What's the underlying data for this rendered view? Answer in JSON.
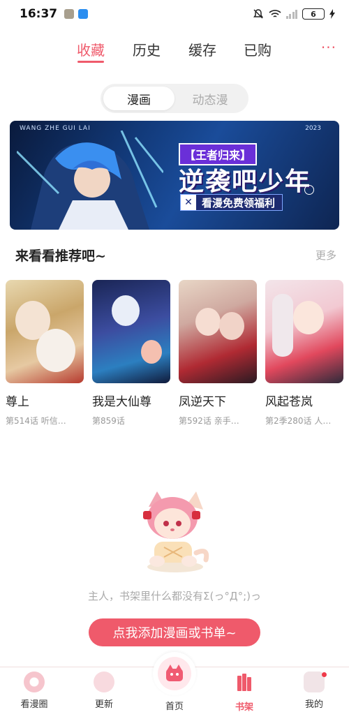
{
  "status_bar": {
    "time": "16:37",
    "battery": "6"
  },
  "top_tabs": [
    {
      "label": "收藏",
      "active": true
    },
    {
      "label": "历史",
      "active": false
    },
    {
      "label": "缓存",
      "active": false
    },
    {
      "label": "已购",
      "active": false
    }
  ],
  "more_dots": "···",
  "segment": [
    {
      "label": "漫画",
      "active": true
    },
    {
      "label": "动态漫",
      "active": false
    }
  ],
  "banner": {
    "deco_text": "WANG ZHE GUI LAI",
    "year": "2023",
    "badge": "【王者归来】",
    "title": "逆袭吧少年",
    "subtitle": "看漫免费领福利"
  },
  "recommend": {
    "title": "来看看推荐吧~",
    "more": "更多",
    "items": [
      {
        "title": "尊上",
        "subtitle": "第514话 听信…"
      },
      {
        "title": "我是大仙尊",
        "subtitle": "第859话"
      },
      {
        "title": "凤逆天下",
        "subtitle": "第592话 亲手…"
      },
      {
        "title": "风起苍岚",
        "subtitle": "第2季280话 人…"
      }
    ]
  },
  "empty_state": {
    "message": "主人，书架里什么都没有Σ(っ°Д°;)っ",
    "button": "点我添加漫画或书单~"
  },
  "bottom_nav": [
    {
      "label": "看漫圈",
      "active": false
    },
    {
      "label": "更新",
      "active": false
    },
    {
      "label": "首页",
      "active": false
    },
    {
      "label": "书架",
      "active": true
    },
    {
      "label": "我的",
      "active": false
    }
  ],
  "colors": {
    "accent": "#ef5a6b",
    "muted": "#aaaaaa"
  }
}
